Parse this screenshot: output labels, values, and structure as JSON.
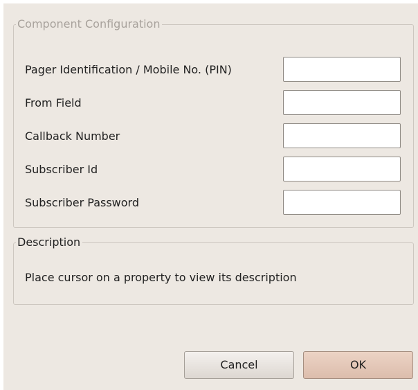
{
  "config_group": {
    "title": "Component Configuration",
    "fields": [
      {
        "label": "Pager Identification / Mobile No. (PIN)",
        "value": ""
      },
      {
        "label": "From Field",
        "value": ""
      },
      {
        "label": "Callback Number",
        "value": ""
      },
      {
        "label": "Subscriber Id",
        "value": ""
      },
      {
        "label": "Subscriber Password",
        "value": ""
      }
    ]
  },
  "description_group": {
    "title": "Description",
    "text": "Place cursor on a property to view its description"
  },
  "buttons": {
    "cancel_label": "Cancel",
    "ok_label": "OK"
  },
  "colors": {
    "dialog_background": "#ede8e2",
    "ok_button": "#e3c8b8",
    "disabled_legend": "#a8a29c"
  }
}
